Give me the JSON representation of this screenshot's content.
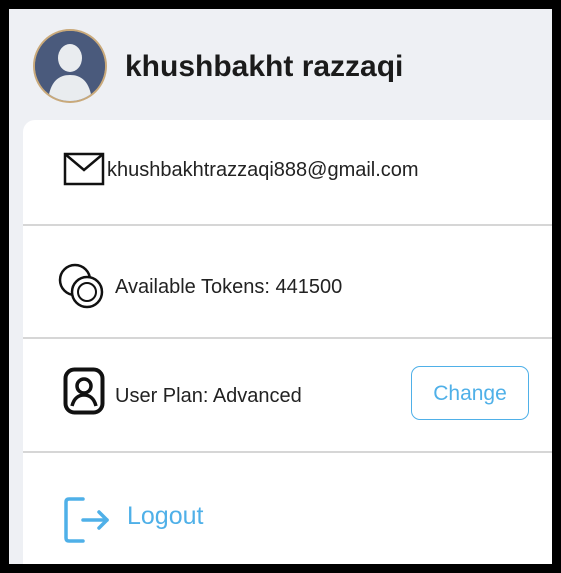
{
  "profile": {
    "user_name": "khushbakht razzaqi",
    "avatar_icon": "user-silhouette-avatar"
  },
  "menu": {
    "email": {
      "icon": "envelope-icon",
      "text": "khushbakhtrazzaqi888@gmail.com"
    },
    "tokens": {
      "icon": "coins-icon",
      "text": "Available Tokens: 441500"
    },
    "plan": {
      "icon": "user-square-icon",
      "text": "User Plan: Advanced",
      "change_label": "Change"
    },
    "logout": {
      "icon": "logout-icon",
      "label": "Logout"
    }
  },
  "colors": {
    "accent": "#4fb0e8",
    "header_background": "#eef0f4",
    "frame": "#000000"
  }
}
